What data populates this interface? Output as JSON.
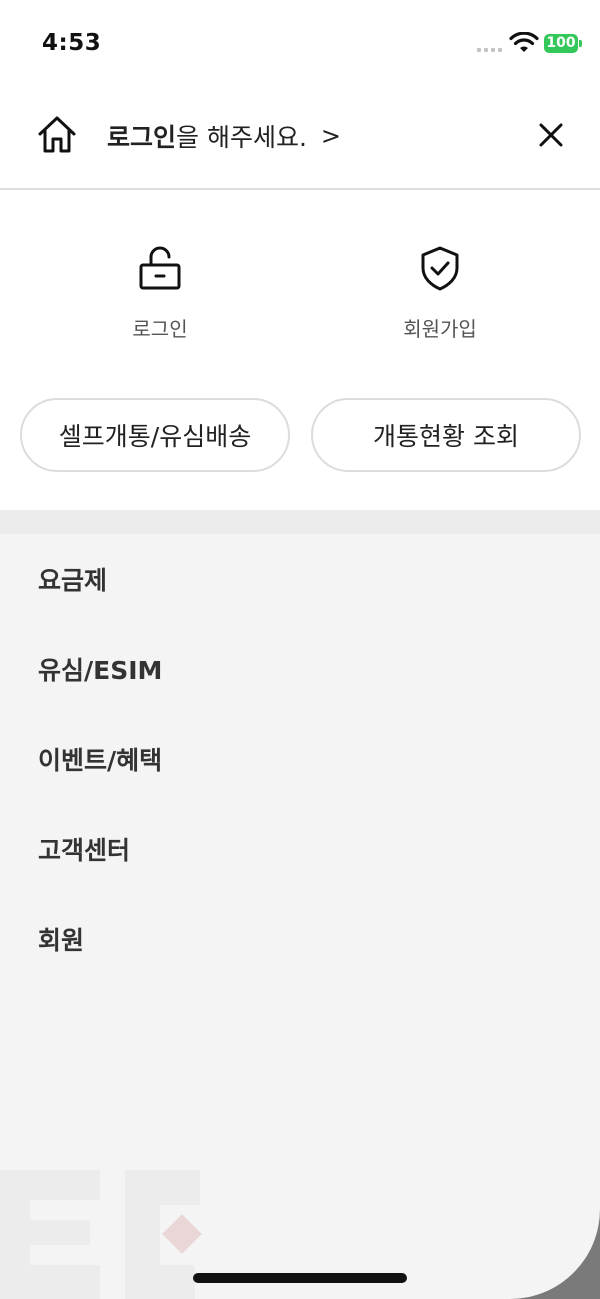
{
  "status_bar": {
    "time": "4:53",
    "battery": "100"
  },
  "header": {
    "login_bold": "로그인",
    "login_rest": "을 해주세요.",
    "chevron": ">"
  },
  "quick_actions": {
    "login_label": "로그인",
    "join_label": "회원가입"
  },
  "pills": {
    "self_open": "셀프개통/유심배송",
    "status_check": "개통현황 조회"
  },
  "menu": {
    "items": [
      {
        "label": "요금제"
      },
      {
        "label": "유심/ESIM"
      },
      {
        "label": "이벤트/혜택"
      },
      {
        "label": "고객센터"
      },
      {
        "label": "회원"
      }
    ]
  },
  "colors": {
    "battery": "#34c759",
    "background": "#f4f4f4",
    "panel": "#ffffff"
  },
  "icons": [
    "home-icon",
    "close-icon",
    "unlock-icon",
    "shield-check-icon",
    "wifi-icon"
  ]
}
